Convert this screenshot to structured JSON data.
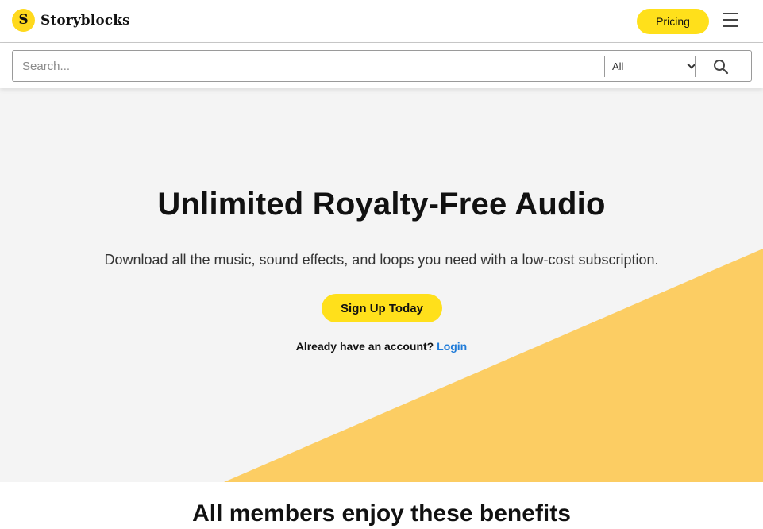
{
  "header": {
    "logo_glyph": "S",
    "brand": "Storyblocks",
    "pricing_label": "Pricing"
  },
  "search": {
    "placeholder": "Search...",
    "category_selected": "All"
  },
  "hero": {
    "title": "Unlimited Royalty-Free Audio",
    "subtitle": "Download all the music, sound effects, and loops you need with a low-cost subscription.",
    "cta_label": "Sign Up Today",
    "account_prompt": "Already have an account?",
    "login_label": "Login"
  },
  "benefits": {
    "title": "All members enjoy these benefits"
  },
  "colors": {
    "accent_yellow": "#ffe01b",
    "hero_shape": "#fccd63",
    "hero_bg": "#f4f4f4",
    "link_blue": "#1f7bd8"
  },
  "icons": {
    "logo": "storyblocks-logo-icon",
    "menu": "hamburger-menu-icon",
    "dropdown": "chevron-down-icon",
    "search": "search-icon"
  }
}
